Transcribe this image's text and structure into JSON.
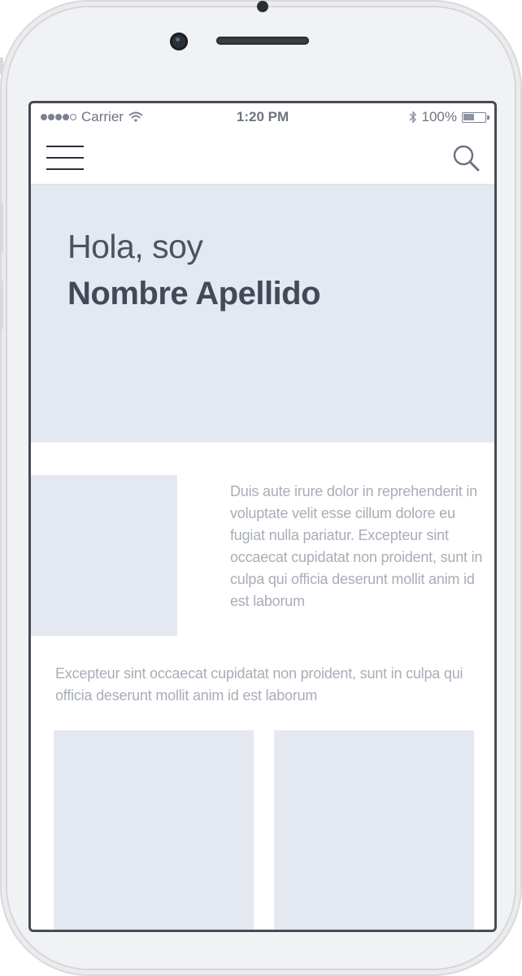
{
  "status_bar": {
    "carrier": "Carrier",
    "time": "1:20 PM",
    "battery": "100%",
    "icons": [
      "signal-dots-icon",
      "wifi-icon",
      "bluetooth-icon",
      "battery-icon"
    ]
  },
  "navbar": {
    "menu_icon": "hamburger-menu-icon",
    "search_icon": "search-icon"
  },
  "hero": {
    "greeting": "Hola, soy",
    "name": "Nombre Apellido"
  },
  "content": {
    "paragraph_right": "Duis aute irure dolor in reprehenderit in voluptate velit esse cillum dolore eu fugiat nulla pariatur. Excepteur sint occaecat cupidatat non proident, sunt in culpa qui officia deserunt mollit anim id est laborum",
    "paragraph_full": "Excepteur sint occaecat cupidatat non proident, sunt in culpa qui officia deserunt mollit anim id est laborum"
  },
  "colors": {
    "placeholder": "#e4e8f1",
    "heading": "#434a57",
    "body_text": "#a8adb8",
    "frame": "#474b54"
  }
}
